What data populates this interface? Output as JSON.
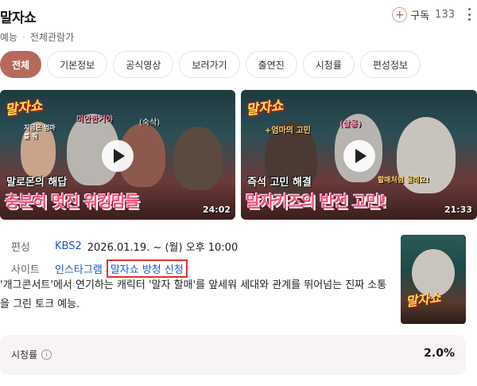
{
  "header": {
    "title": "말자쇼",
    "genre": "예능",
    "rating_label": "전체관람가",
    "subscribe_label": "구독",
    "subscribe_count": "133"
  },
  "tabs": [
    "전체",
    "기본정보",
    "공식영상",
    "보러가기",
    "출연진",
    "시청률",
    "편성정보"
  ],
  "videos": [
    {
      "caption_top": "말로몬의 해답",
      "caption_main": "충분히 멋진 워킹맘들",
      "duration": "24:02",
      "tags": [
        "미안한거야",
        "지금은 엄마를 줘",
        "(숙삭)"
      ]
    },
    {
      "caption_top": "즉석 고민 해결",
      "caption_main": "말자키즈의 반전 고민!",
      "duration": "21:33",
      "tags": [
        "+엄마의 고민",
        "(살롱)",
        "할매처럼 될래요!"
      ]
    }
  ],
  "info": {
    "schedule_label": "편성",
    "channel": "KBS2",
    "schedule": "2026.01.19. ~  (월) 오후 10:00",
    "site_label": "사이트",
    "site_links": [
      "인스타그램",
      "말자쇼 방청 신청"
    ]
  },
  "description": "'개그콘서트'에서 연기하는 캐릭터 '말자 할매'를 앞세워 세대와 관계를 뛰어넘는 진짜 소통을 그린 토크 예능.",
  "poster": {
    "logo_text": "말자쇼"
  },
  "viewership": {
    "label": "시청률",
    "value": "2.0%"
  },
  "colors": {
    "accent": "#b76a5c",
    "link": "#1a56c7",
    "highlight_box": "#e6302a"
  },
  "icons": {
    "subscribe": "plus-circle-icon",
    "more": "more-vertical-icon",
    "info": "info-circle-icon",
    "play": "play-icon"
  }
}
